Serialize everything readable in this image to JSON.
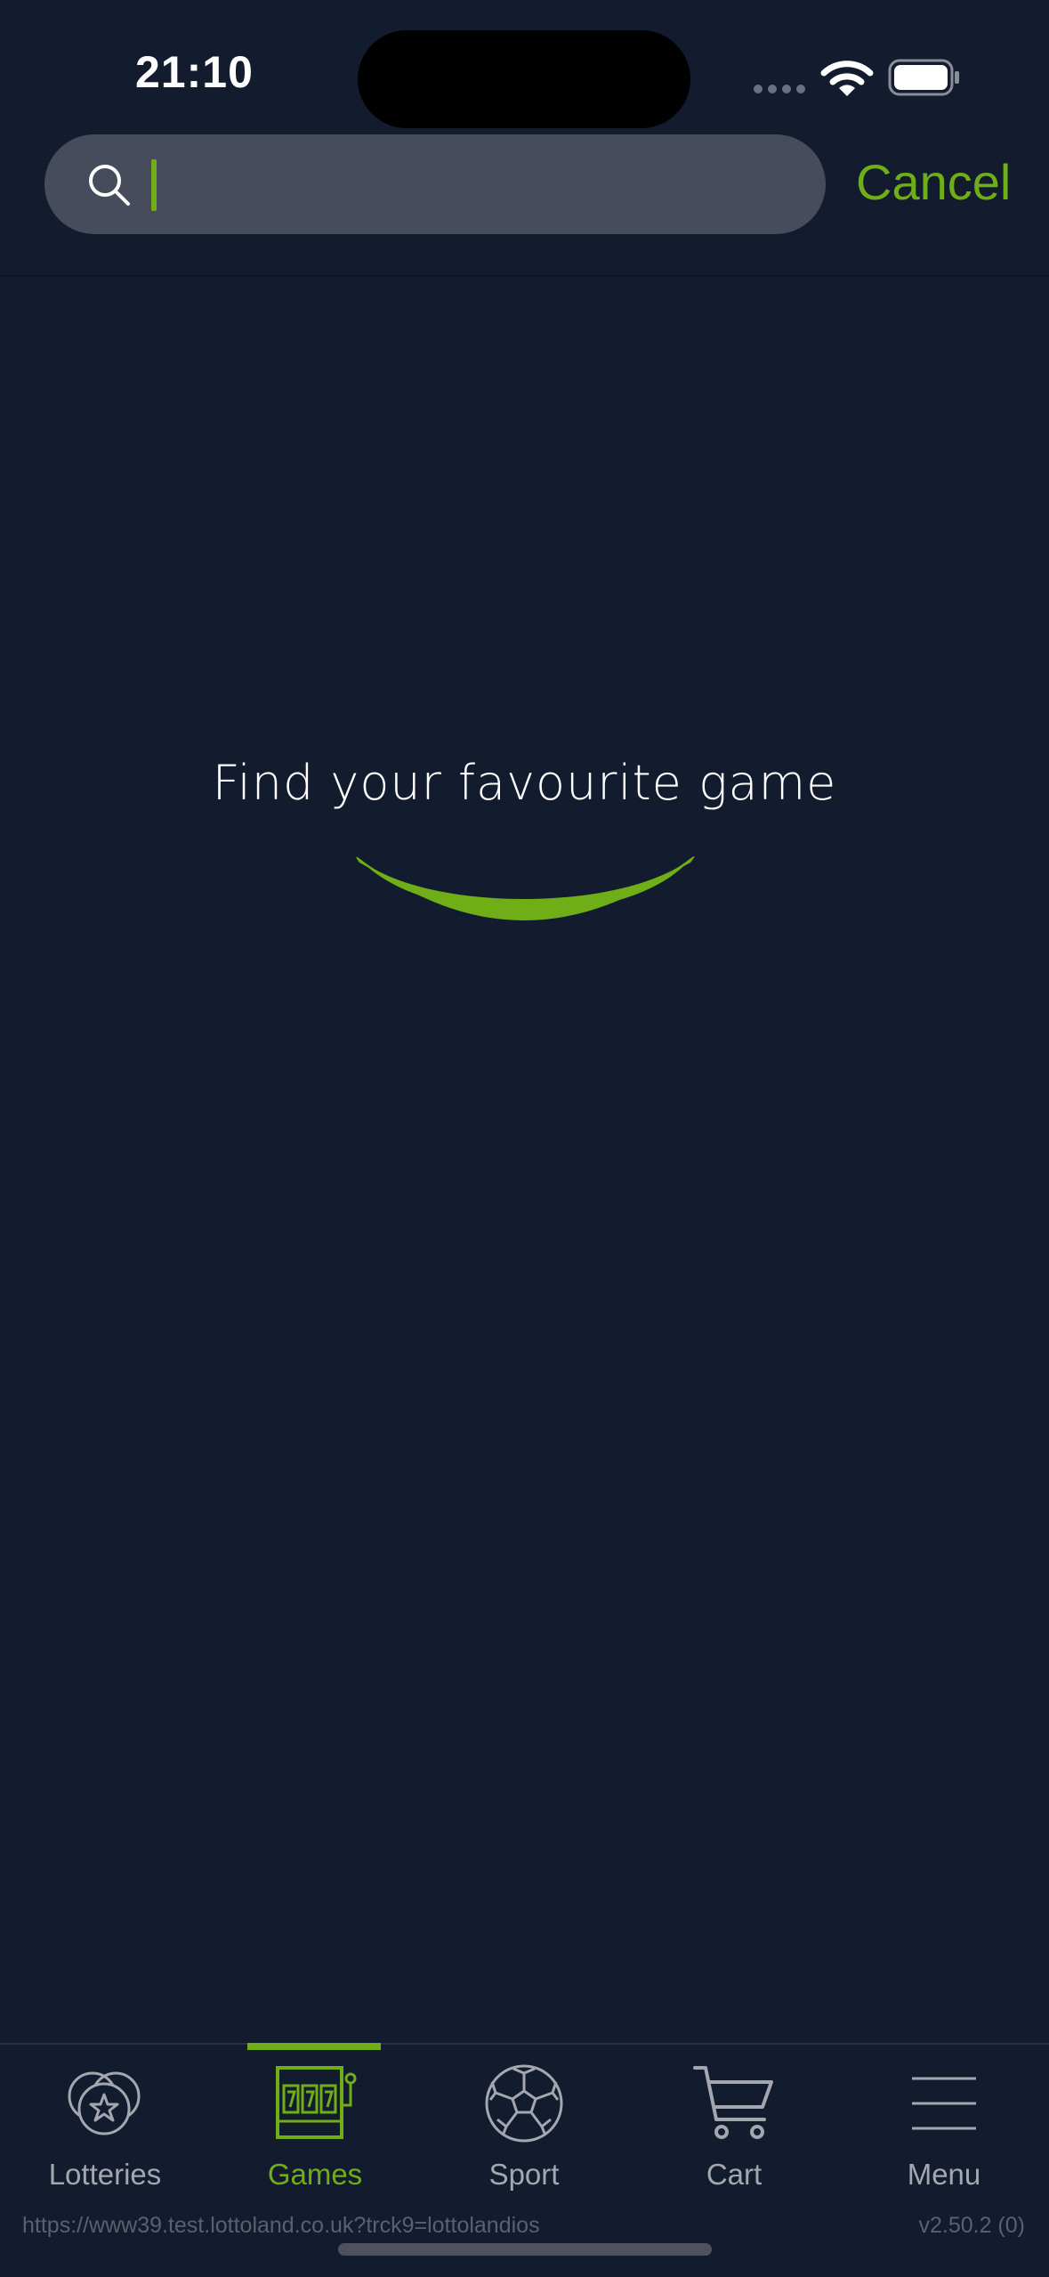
{
  "status_bar": {
    "time": "21:10"
  },
  "search": {
    "placeholder": "",
    "value": "",
    "cancel_label": "Cancel"
  },
  "empty_state": {
    "title": "Find your favourite game"
  },
  "tabs": [
    {
      "label": "Lotteries",
      "icon": "lotteries-icon",
      "active": false
    },
    {
      "label": "Games",
      "icon": "slot-machine-icon",
      "active": true
    },
    {
      "label": "Sport",
      "icon": "soccer-ball-icon",
      "active": false
    },
    {
      "label": "Cart",
      "icon": "cart-icon",
      "active": false
    },
    {
      "label": "Menu",
      "icon": "hamburger-menu-icon",
      "active": false
    }
  ],
  "footer": {
    "url": "https://www39.test.lottoland.co.uk?trck9=lottolandios",
    "version": "v2.50.2 (0)"
  },
  "colors": {
    "background": "#131b2e",
    "accent": "#6fae17",
    "search_field": "#474c5c",
    "inactive_tab": "#a4a7b0"
  }
}
